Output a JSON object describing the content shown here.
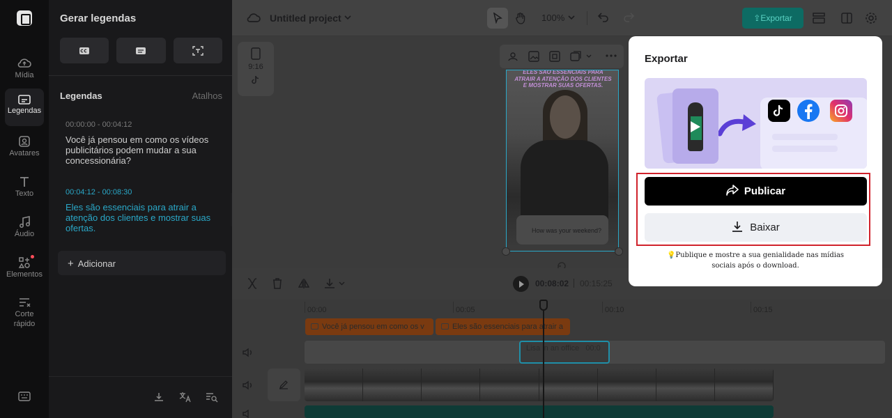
{
  "rail": {
    "items": [
      {
        "label": "Mídia",
        "icon": "cloud-upload-icon"
      },
      {
        "label": "Legendas",
        "icon": "captions-icon"
      },
      {
        "label": "Avatares",
        "icon": "avatar-icon"
      },
      {
        "label": "Texto",
        "icon": "text-icon"
      },
      {
        "label": "Áudio",
        "icon": "music-icon"
      },
      {
        "label": "Elementos",
        "icon": "elements-icon"
      },
      {
        "label": "Corte rápido",
        "icon": "quick-cut-icon"
      }
    ]
  },
  "panel": {
    "title": "Gerar legendas",
    "section_label": "Legendas",
    "shortcuts_link": "Atalhos",
    "captions": [
      {
        "time": "00:00:00 - 00:04:12",
        "text": "Você já pensou em como os vídeos publicitários podem mudar a sua concessionária?"
      },
      {
        "time": "00:04:12 - 00:08:30",
        "text": "Eles são essenciais para atrair a atenção dos clientes e mostrar suas ofertas."
      }
    ],
    "add_label": "Adicionar"
  },
  "topbar": {
    "project_name": "Untitled project",
    "zoom": "100%",
    "export_label": "Exportar"
  },
  "canvas": {
    "ratio_label": "9:16",
    "video_caption": "Eles são essenciais para atrair a atenção dos clientes e mostrar suas ofertas.",
    "chat_text": "How was your weekend?"
  },
  "timeline": {
    "current_time": "00:08:02",
    "total_time": "00:15:25",
    "ruler": [
      "00:00",
      "00:05",
      "00:10",
      "00:15"
    ],
    "caption_clips": [
      "Você já pensou em como os v",
      "Eles são essenciais para atrair a"
    ],
    "avatar_clip_label": "Lisa in an office",
    "avatar_clip_time": "00:0"
  },
  "modal": {
    "title": "Exportar",
    "publish_label": "Publicar",
    "download_label": "Baixar",
    "hint": "Publique e mostre a sua genialidade nas mídias sociais após o download."
  },
  "colors": {
    "accent": "#2aa8c8",
    "highlight_border": "#d0222b",
    "publish_bg": "#000000",
    "banner_bg": "#dcd6f5"
  }
}
